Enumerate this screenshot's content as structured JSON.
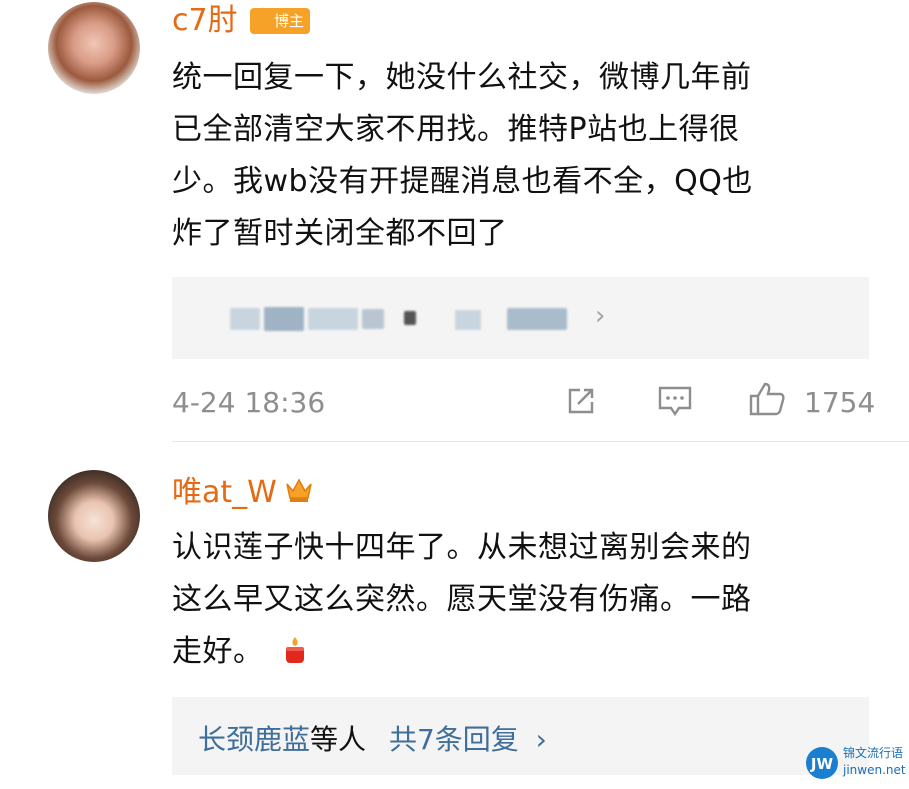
{
  "comments": [
    {
      "username": "c7肘",
      "badge": "博主",
      "text_lines": [
        "统一回复一下，她没什么社交，微博几年前",
        "已全部清空大家不用找。推特P站也上得很",
        "少。我wb没有开提醒消息也看不全，QQ也",
        "炸了暂时关闭全都不回了"
      ],
      "timestamp": "4-24 18:36",
      "likes": "1754"
    },
    {
      "username": "唯at_W",
      "text_lines": [
        "认识莲子快十四年了。从未想过离别会来的",
        "这么早又这么突然。愿天堂没有伤痛。一路",
        "走好。"
      ],
      "reply_users": "长颈鹿蓝",
      "reply_suffix": "等人",
      "reply_count": "共7条回复"
    }
  ],
  "watermark": {
    "logo": "JW",
    "name": "锦文流行语",
    "url": "jinwen.net"
  },
  "icons": [
    "share-icon",
    "comment-icon",
    "like-icon",
    "crown-icon",
    "candle-emoji-icon",
    "chevron-right-icon"
  ],
  "colors": {
    "username": "#e56a14",
    "link": "#3f6e9b",
    "meta": "#8e8e8e",
    "badge": "#f6a127"
  }
}
